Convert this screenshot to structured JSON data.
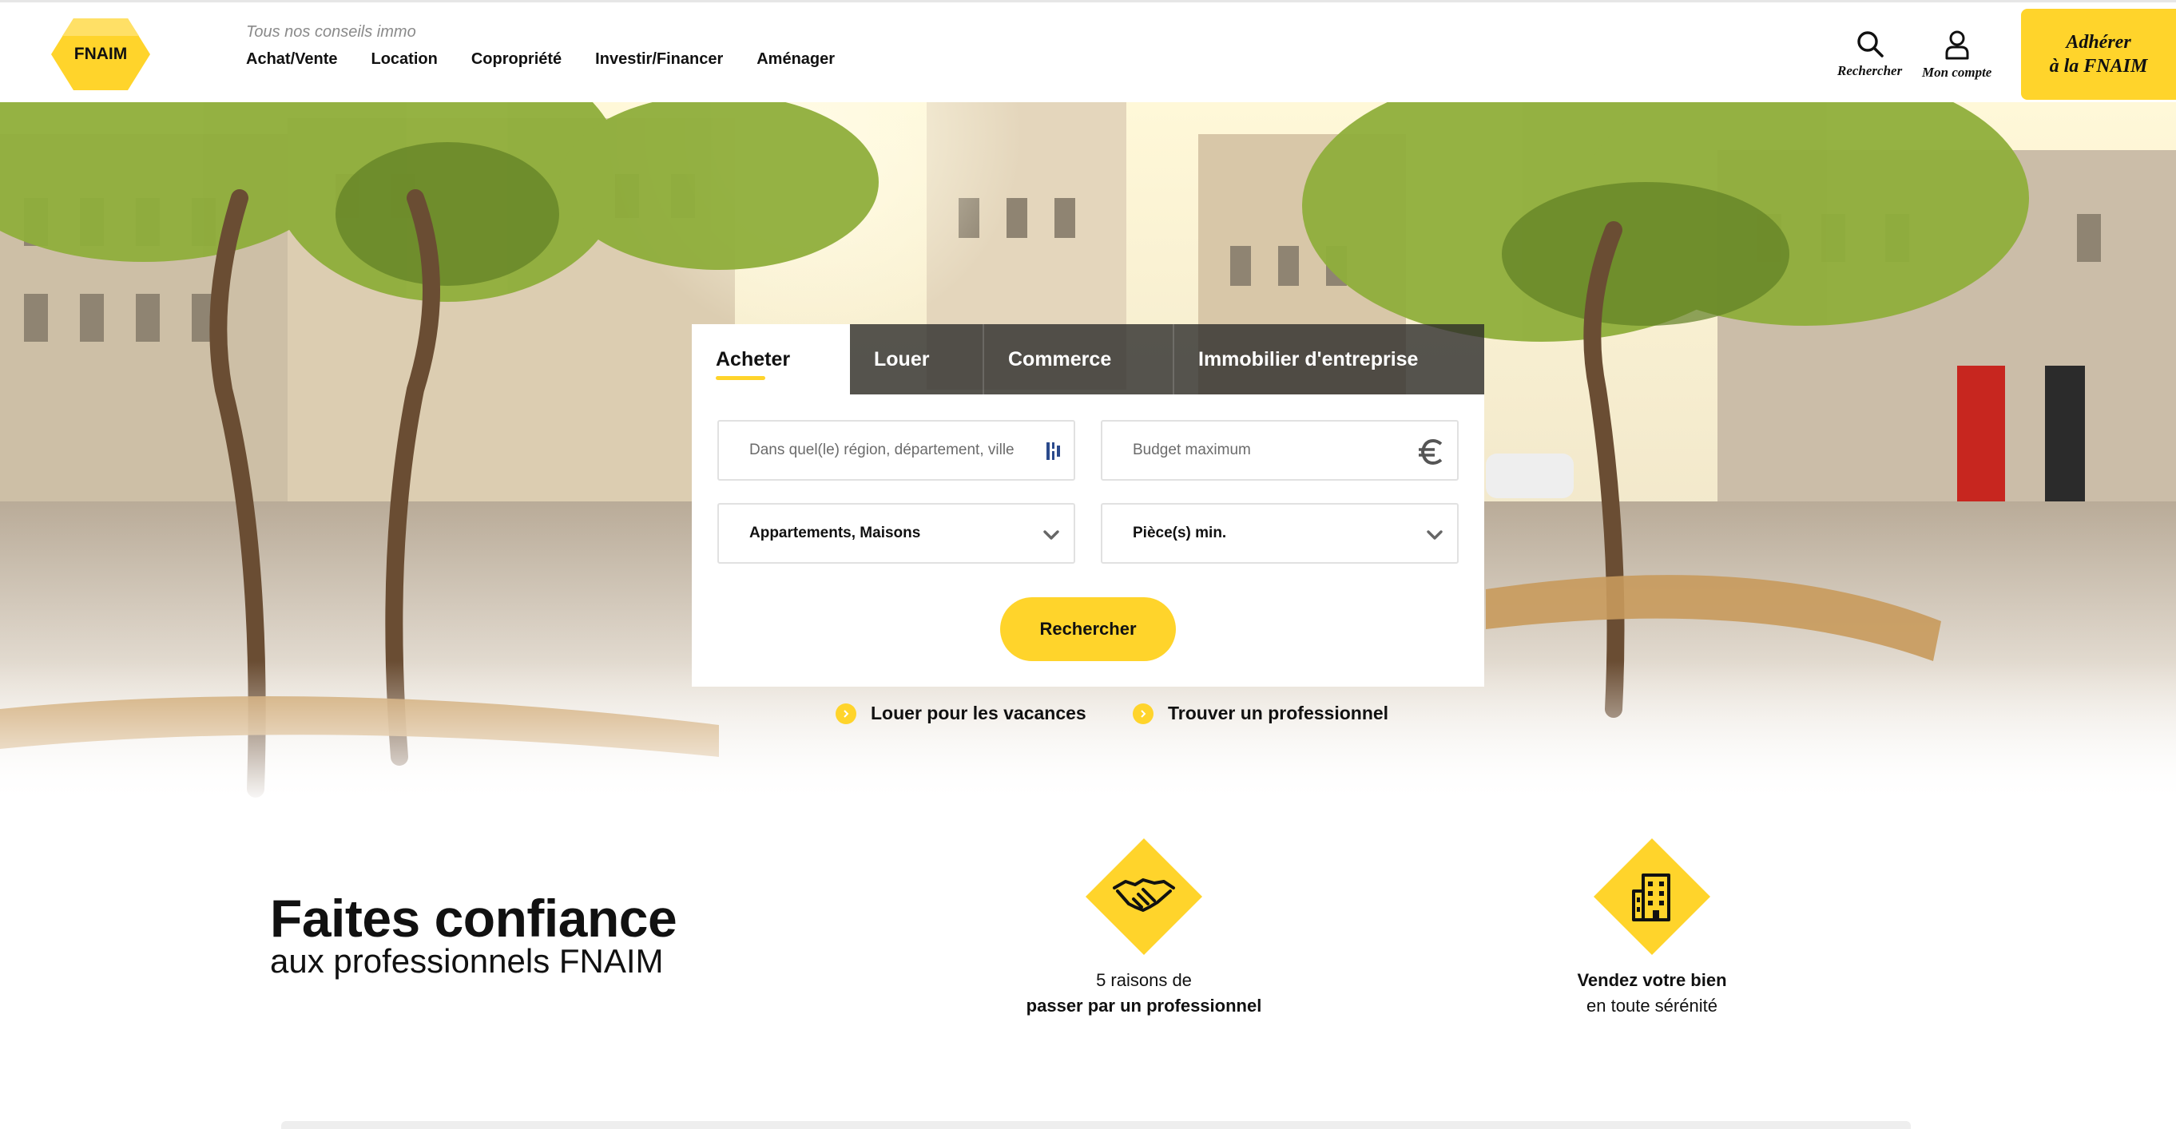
{
  "header": {
    "logo_text": "FNAIM",
    "tagline": "Tous nos conseils immo",
    "nav": [
      {
        "label": "Achat/Vente"
      },
      {
        "label": "Location"
      },
      {
        "label": "Copropriété"
      },
      {
        "label": "Investir/Financer"
      },
      {
        "label": "Aménager"
      }
    ],
    "search_label": "Rechercher",
    "account_label": "Mon compte",
    "join_line1": "Adhérer",
    "join_line2": "à la FNAIM"
  },
  "search": {
    "tabs": [
      {
        "label": "Acheter",
        "active": true
      },
      {
        "label": "Louer",
        "active": false
      },
      {
        "label": "Commerce",
        "active": false
      },
      {
        "label": "Immobilier d'entreprise",
        "active": false
      }
    ],
    "location_placeholder": "Dans quel(le) région, département, ville",
    "budget_placeholder": "Budget maximum",
    "type_value": "Appartements, Maisons",
    "rooms_value": "Pièce(s) min.",
    "submit_label": "Rechercher"
  },
  "quicklinks": [
    {
      "label": "Louer pour les vacances"
    },
    {
      "label": "Trouver un professionnel"
    }
  ],
  "trust": {
    "title": "Faites confiance",
    "subtitle": "aux professionnels FNAIM",
    "features": [
      {
        "line1": "5 raisons de",
        "line2": "passer par un professionnel",
        "icon": "handshake-icon"
      },
      {
        "line1": "Vendez votre bien",
        "line2": "en toute sérénité",
        "icon": "building-icon"
      }
    ]
  },
  "colors": {
    "accent": "#ffd42b",
    "tab_bar": "#282828",
    "text": "#111111"
  }
}
